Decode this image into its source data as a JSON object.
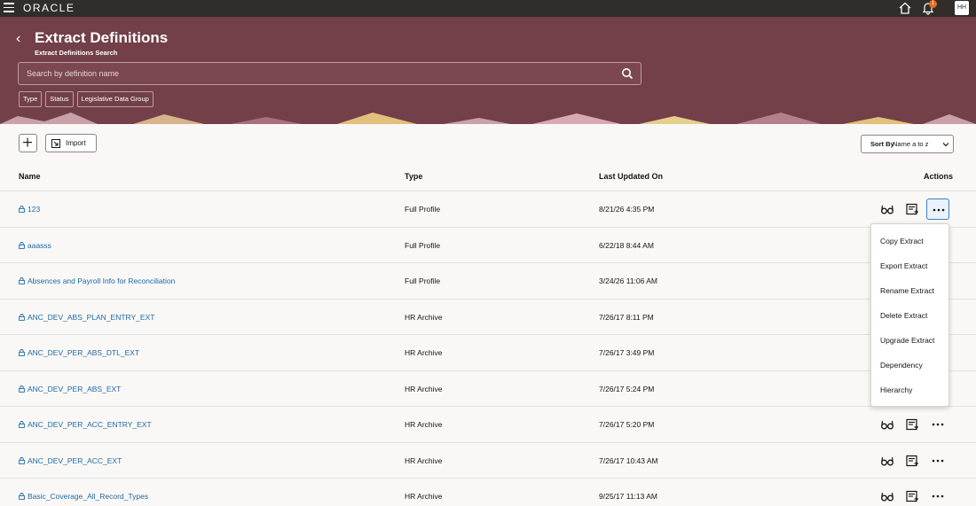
{
  "topbar": {
    "brand": "ORACLE",
    "notification_count": "1",
    "user_initials": "HH"
  },
  "header": {
    "title": "Extract Definitions",
    "subtitle": "Extract Definitions Search",
    "search_placeholder": "Search by definition name",
    "filters": [
      "Type",
      "Status",
      "Legislative Data Group"
    ]
  },
  "toolbar": {
    "import_label": "Import",
    "sort_prefix": "Sort By",
    "sort_value": "Name a to z"
  },
  "table": {
    "columns": {
      "name": "Name",
      "type": "Type",
      "updated": "Last Updated On",
      "actions": "Actions"
    },
    "rows": [
      {
        "name": "123",
        "type": "Full Profile",
        "updated": "8/21/26 4:35 PM"
      },
      {
        "name": "aaasss",
        "type": "Full Profile",
        "updated": "6/22/18 8:44 AM"
      },
      {
        "name": "Absences and Payroll Info for Reconciliation",
        "type": "Full Profile",
        "updated": "3/24/26 11:06 AM"
      },
      {
        "name": "ANC_DEV_ABS_PLAN_ENTRY_EXT",
        "type": "HR Archive",
        "updated": "7/26/17 8:11 PM"
      },
      {
        "name": "ANC_DEV_PER_ABS_DTL_EXT",
        "type": "HR Archive",
        "updated": "7/26/17 3:49 PM"
      },
      {
        "name": "ANC_DEV_PER_ABS_EXT",
        "type": "HR Archive",
        "updated": "7/26/17 5:24 PM"
      },
      {
        "name": "ANC_DEV_PER_ACC_ENTRY_EXT",
        "type": "HR Archive",
        "updated": "7/26/17 5:20 PM"
      },
      {
        "name": "ANC_DEV_PER_ACC_EXT",
        "type": "HR Archive",
        "updated": "7/26/17 10:43 AM"
      },
      {
        "name": "Basic_Coverage_All_Record_Types",
        "type": "HR Archive",
        "updated": "9/25/17 11:13 AM"
      }
    ]
  },
  "actions_menu": {
    "items": [
      "Copy Extract",
      "Export Extract",
      "Rename Extract",
      "Delete Extract",
      "Upgrade Extract",
      "Dependency",
      "Hierarchy"
    ]
  }
}
